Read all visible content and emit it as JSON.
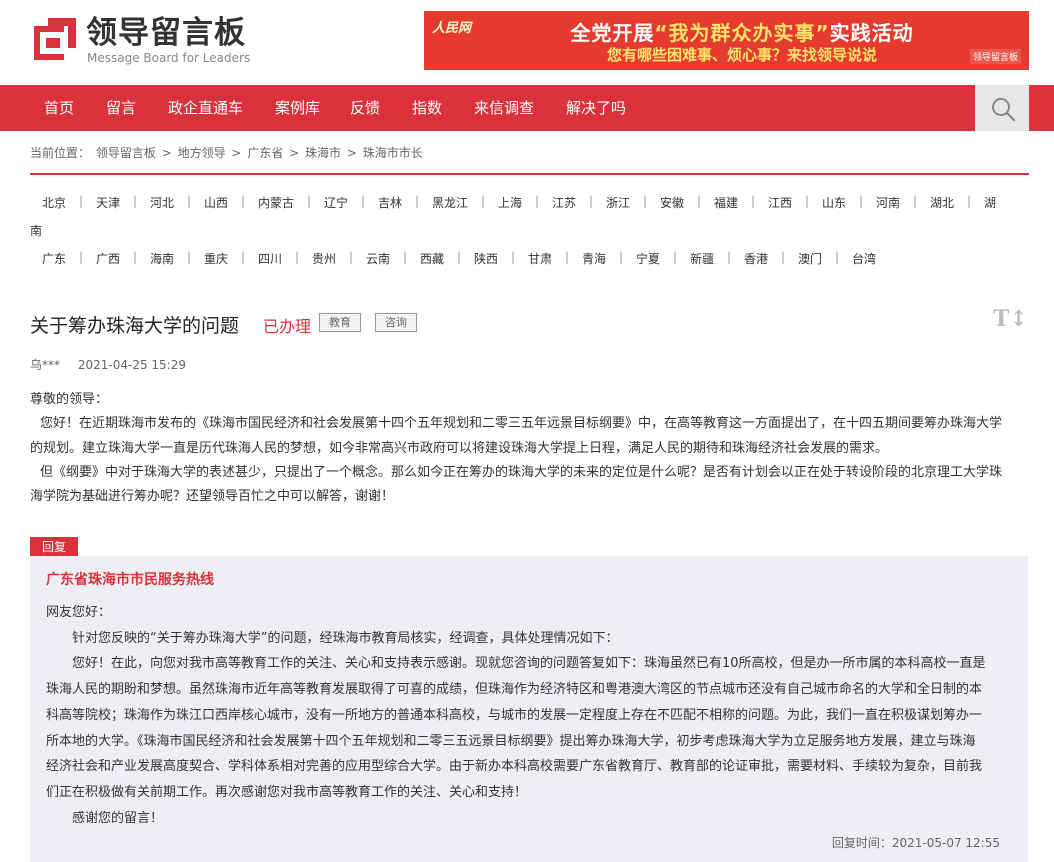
{
  "site": {
    "logo_cn": "领导留言板",
    "logo_en": "Message Board for Leaders"
  },
  "banner": {
    "brand_mark": "人民网",
    "line1_prefix": "全党开展",
    "line1_highlight": "“我为群众办实事”",
    "line1_suffix": "实践活动",
    "line2": "您有哪些困难事、烦心事？来找领导说说",
    "brand_tag": "领导留言板"
  },
  "nav": {
    "items": [
      "首页",
      "留言",
      "政企直通车",
      "案例库",
      "反馈",
      "指数",
      "来信调查",
      "解决了吗"
    ]
  },
  "breadcrumb": {
    "prefix": "当前位置：",
    "items": [
      "领导留言板",
      "地方领导",
      "广东省",
      "珠海市",
      "珠海市市长"
    ],
    "sep": ">"
  },
  "regions": {
    "row1": [
      "北京",
      "天津",
      "河北",
      "山西",
      "内蒙古",
      "辽宁",
      "吉林",
      "黑龙江",
      "上海",
      "江苏",
      "浙江",
      "安徽",
      "福建",
      "江西",
      "山东",
      "河南",
      "湖北",
      "湖"
    ],
    "row1_wrap": "南",
    "row2": [
      "广东",
      "广西",
      "海南",
      "重庆",
      "四川",
      "贵州",
      "云南",
      "西藏",
      "陕西",
      "甘肃",
      "青海",
      "宁夏",
      "新疆",
      "香港",
      "澳门",
      "台湾"
    ]
  },
  "message": {
    "title": "关于筹办珠海大学的问题",
    "status": "已办理",
    "tags": [
      "教育",
      "咨询"
    ],
    "font_toggle": "T↕",
    "author": "乌***",
    "date": "2021-04-25 15:29",
    "greeting": "尊敬的领导：",
    "para1_l1": "您好！在近期珠海市发布的《珠海市国民经济和社会发展第十四个五年规划和二零三五年远景目标纲要》中，在高等教育这一方面提出了，在十四五期间要筹办珠海大学",
    "para1_l2": "的规划。建立珠海大学一直是历代珠海人民的梦想，如今非常高兴市政府可以将建设珠海大学提上日程，满足人民的期待和珠海经济社会发展的需求。",
    "para2_l1": "但《纲要》中对于珠海大学的表述甚少，只提出了一个概念。那么如今正在筹办的珠海大学的未来的定位是什么呢？是否有计划会以正在处于转设阶段的北京理工大学珠",
    "para2_l2": "海学院为基础进行筹办呢？还望领导百忙之中可以解答，谢谢！"
  },
  "reply": {
    "tag": "回复",
    "org": "广东省珠海市市民服务热线",
    "greeting": "网友您好：",
    "l1": "针对您反映的“关于筹办珠海大学”的问题，经珠海市教育局核实，经调查，具体处理情况如下：",
    "l2": "您好！在此，向您对我市高等教育工作的关注、关心和支持表示感谢。现就您咨询的问题答复如下：珠海虽然已有10所高校，但是办一所市属的本科高校一直是",
    "l3": "珠海人民的期盼和梦想。虽然珠海市近年高等教育发展取得了可喜的成绩，但珠海作为经济特区和粤港澳大湾区的节点城市还没有自己城市命名的大学和全日制的本",
    "l4": "科高等院校；珠海作为珠江口西岸核心城市，没有一所地方的普通本科高校，与城市的发展一定程度上存在不匹配不相称的问题。为此，我们一直在积极谋划筹办一",
    "l5": "所本地的大学。《珠海市国民经济和社会发展第十四个五年规划和二零三五远景目标纲要》提出筹办珠海大学，初步考虑珠海大学为立足服务地方发展，建立与珠海",
    "l6": "经济社会和产业发展高度契合、学科体系相对完善的应用型综合大学。由于新办本科高校需要广东省教育厅、教育部的论证审批，需要材料、手续较为复杂，目前我",
    "l7": "们正在积极做有关前期工作。再次感谢您对我市高等教育工作的关注、关心和支持！",
    "l8": "感谢您的留言！",
    "time_label": "回复时间：",
    "time": "2021-05-07 12:55"
  },
  "colors": {
    "brand_red": "#d9323c",
    "reply_bg": "#eeeff4"
  },
  "icons": {
    "search": "magnifier-icon",
    "logo": "logo-mark-icon"
  }
}
